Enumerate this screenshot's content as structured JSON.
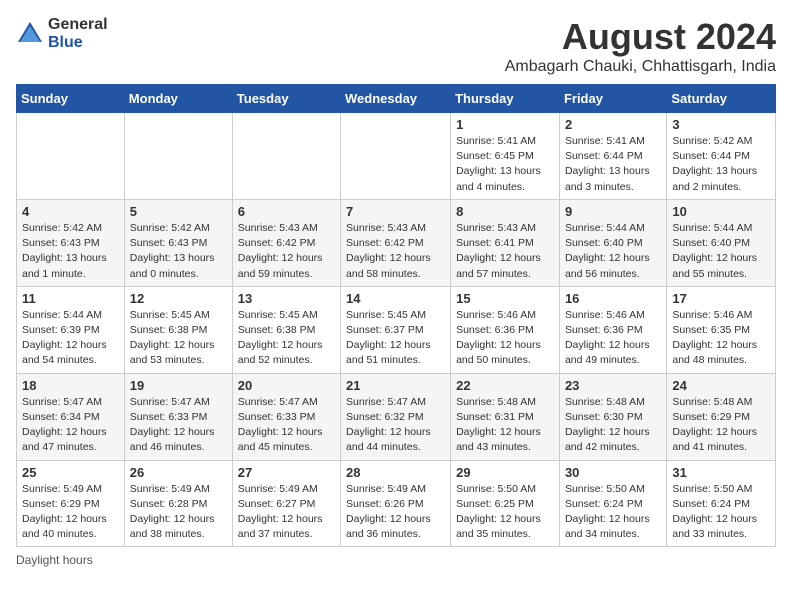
{
  "logo": {
    "general": "General",
    "blue": "Blue"
  },
  "title": "August 2024",
  "subtitle": "Ambagarh Chauki, Chhattisgarh, India",
  "days_of_week": [
    "Sunday",
    "Monday",
    "Tuesday",
    "Wednesday",
    "Thursday",
    "Friday",
    "Saturday"
  ],
  "weeks": [
    [
      {
        "day": "",
        "info": ""
      },
      {
        "day": "",
        "info": ""
      },
      {
        "day": "",
        "info": ""
      },
      {
        "day": "",
        "info": ""
      },
      {
        "day": "1",
        "info": "Sunrise: 5:41 AM\nSunset: 6:45 PM\nDaylight: 13 hours\nand 4 minutes."
      },
      {
        "day": "2",
        "info": "Sunrise: 5:41 AM\nSunset: 6:44 PM\nDaylight: 13 hours\nand 3 minutes."
      },
      {
        "day": "3",
        "info": "Sunrise: 5:42 AM\nSunset: 6:44 PM\nDaylight: 13 hours\nand 2 minutes."
      }
    ],
    [
      {
        "day": "4",
        "info": "Sunrise: 5:42 AM\nSunset: 6:43 PM\nDaylight: 13 hours\nand 1 minute."
      },
      {
        "day": "5",
        "info": "Sunrise: 5:42 AM\nSunset: 6:43 PM\nDaylight: 13 hours\nand 0 minutes."
      },
      {
        "day": "6",
        "info": "Sunrise: 5:43 AM\nSunset: 6:42 PM\nDaylight: 12 hours\nand 59 minutes."
      },
      {
        "day": "7",
        "info": "Sunrise: 5:43 AM\nSunset: 6:42 PM\nDaylight: 12 hours\nand 58 minutes."
      },
      {
        "day": "8",
        "info": "Sunrise: 5:43 AM\nSunset: 6:41 PM\nDaylight: 12 hours\nand 57 minutes."
      },
      {
        "day": "9",
        "info": "Sunrise: 5:44 AM\nSunset: 6:40 PM\nDaylight: 12 hours\nand 56 minutes."
      },
      {
        "day": "10",
        "info": "Sunrise: 5:44 AM\nSunset: 6:40 PM\nDaylight: 12 hours\nand 55 minutes."
      }
    ],
    [
      {
        "day": "11",
        "info": "Sunrise: 5:44 AM\nSunset: 6:39 PM\nDaylight: 12 hours\nand 54 minutes."
      },
      {
        "day": "12",
        "info": "Sunrise: 5:45 AM\nSunset: 6:38 PM\nDaylight: 12 hours\nand 53 minutes."
      },
      {
        "day": "13",
        "info": "Sunrise: 5:45 AM\nSunset: 6:38 PM\nDaylight: 12 hours\nand 52 minutes."
      },
      {
        "day": "14",
        "info": "Sunrise: 5:45 AM\nSunset: 6:37 PM\nDaylight: 12 hours\nand 51 minutes."
      },
      {
        "day": "15",
        "info": "Sunrise: 5:46 AM\nSunset: 6:36 PM\nDaylight: 12 hours\nand 50 minutes."
      },
      {
        "day": "16",
        "info": "Sunrise: 5:46 AM\nSunset: 6:36 PM\nDaylight: 12 hours\nand 49 minutes."
      },
      {
        "day": "17",
        "info": "Sunrise: 5:46 AM\nSunset: 6:35 PM\nDaylight: 12 hours\nand 48 minutes."
      }
    ],
    [
      {
        "day": "18",
        "info": "Sunrise: 5:47 AM\nSunset: 6:34 PM\nDaylight: 12 hours\nand 47 minutes."
      },
      {
        "day": "19",
        "info": "Sunrise: 5:47 AM\nSunset: 6:33 PM\nDaylight: 12 hours\nand 46 minutes."
      },
      {
        "day": "20",
        "info": "Sunrise: 5:47 AM\nSunset: 6:33 PM\nDaylight: 12 hours\nand 45 minutes."
      },
      {
        "day": "21",
        "info": "Sunrise: 5:47 AM\nSunset: 6:32 PM\nDaylight: 12 hours\nand 44 minutes."
      },
      {
        "day": "22",
        "info": "Sunrise: 5:48 AM\nSunset: 6:31 PM\nDaylight: 12 hours\nand 43 minutes."
      },
      {
        "day": "23",
        "info": "Sunrise: 5:48 AM\nSunset: 6:30 PM\nDaylight: 12 hours\nand 42 minutes."
      },
      {
        "day": "24",
        "info": "Sunrise: 5:48 AM\nSunset: 6:29 PM\nDaylight: 12 hours\nand 41 minutes."
      }
    ],
    [
      {
        "day": "25",
        "info": "Sunrise: 5:49 AM\nSunset: 6:29 PM\nDaylight: 12 hours\nand 40 minutes."
      },
      {
        "day": "26",
        "info": "Sunrise: 5:49 AM\nSunset: 6:28 PM\nDaylight: 12 hours\nand 38 minutes."
      },
      {
        "day": "27",
        "info": "Sunrise: 5:49 AM\nSunset: 6:27 PM\nDaylight: 12 hours\nand 37 minutes."
      },
      {
        "day": "28",
        "info": "Sunrise: 5:49 AM\nSunset: 6:26 PM\nDaylight: 12 hours\nand 36 minutes."
      },
      {
        "day": "29",
        "info": "Sunrise: 5:50 AM\nSunset: 6:25 PM\nDaylight: 12 hours\nand 35 minutes."
      },
      {
        "day": "30",
        "info": "Sunrise: 5:50 AM\nSunset: 6:24 PM\nDaylight: 12 hours\nand 34 minutes."
      },
      {
        "day": "31",
        "info": "Sunrise: 5:50 AM\nSunset: 6:24 PM\nDaylight: 12 hours\nand 33 minutes."
      }
    ]
  ],
  "footer": "Daylight hours"
}
